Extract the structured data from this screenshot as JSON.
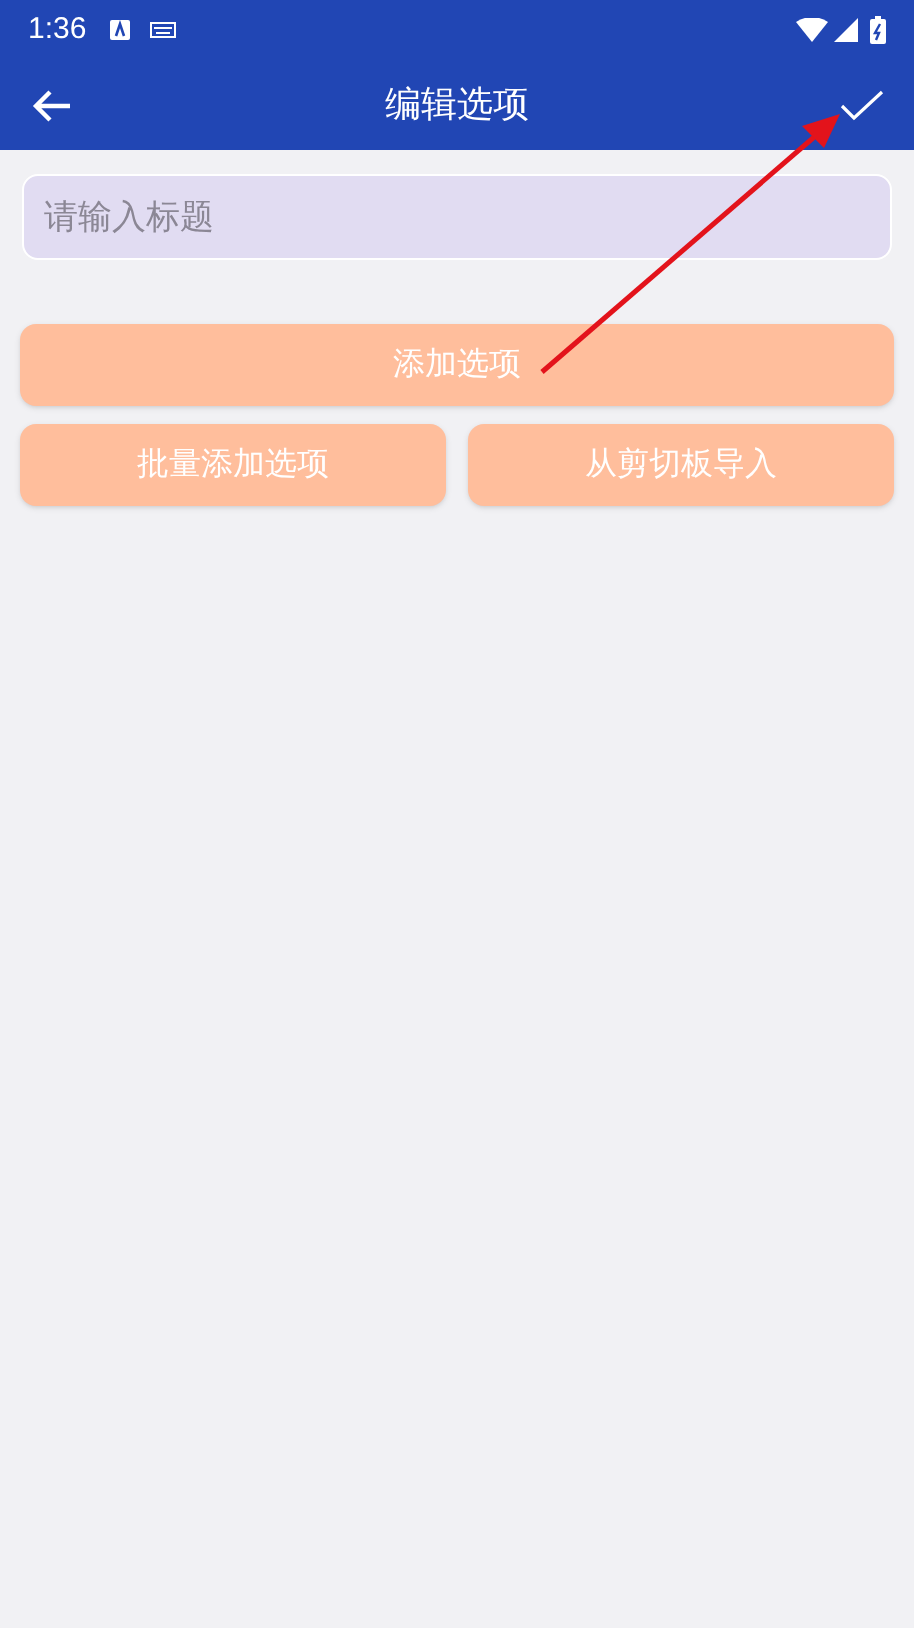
{
  "status_bar": {
    "time": "1:36"
  },
  "app_bar": {
    "title": "编辑选项"
  },
  "title_field": {
    "placeholder": "请输入标题"
  },
  "primary_button": "添加选项",
  "buttons": [
    "批量添加选项",
    "从剪切板导入"
  ]
}
